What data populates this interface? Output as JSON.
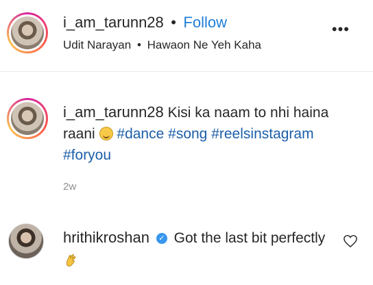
{
  "post": {
    "author": "i_am_tarunn28",
    "separator": "•",
    "follow_label": "Follow",
    "artist": "Udit Narayan",
    "song": "Hawaon Ne Yeh Kaha",
    "more_label": "•••"
  },
  "caption": {
    "author": "i_am_tarunn28",
    "text": "Kisi ka naam to nhi haina raani",
    "emoji": "smiling-face-icon",
    "hashtags": [
      "#dance",
      "#song",
      "#reelsinstagram",
      "#foryou"
    ],
    "time": "2w"
  },
  "comment": {
    "author": "hrithikroshan",
    "text": "Got the last bit perfectly",
    "emoji": "clapping-hands-icon"
  },
  "colors": {
    "follow": "#1f7fd6",
    "hashtag": "#1a5ea8",
    "verified": "#3897f0",
    "muted": "#8e8e8e"
  }
}
